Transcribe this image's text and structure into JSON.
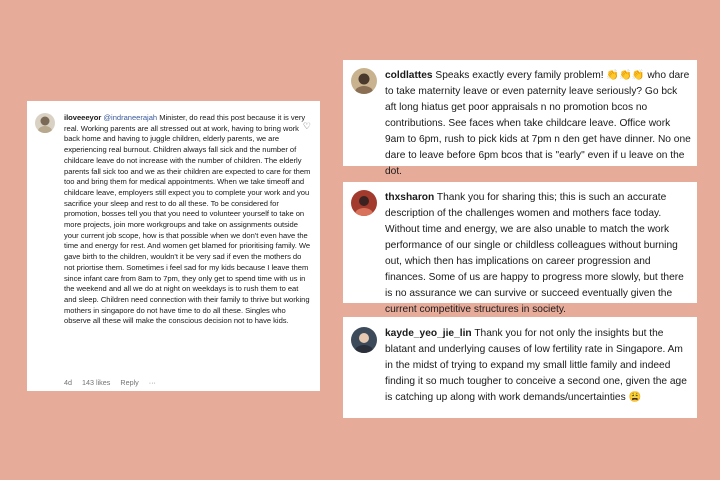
{
  "comments": {
    "left": {
      "username": "iloveeeyor",
      "mention": "@indraneerajah",
      "text": "Minister, do read this post because it is very real. Working parents are all stressed out at work, having to bring work back home and having to juggle children, elderly parents, we are experiencing real burnout. Children always fall sick and the number of childcare leave do not increase with the number of children. The elderly parents fall sick too and we as their children are expected to care for them too and bring them for medical appointments. When we take timeoff and childcare leave, employers still expect you to complete your work and you sacrifice your sleep and rest to do all these. To be considered for promotion, bosses tell you that you need to volunteer yourself to take on more projects, join more workgroups and take on assignments outside your current job scope, how is that possible when we don't even have the time and energy for rest. And women get blamed for prioritising family. We gave birth to the children, wouldn't it be very sad if even the mothers do not priortise them. Sometimes i feel sad for my kids because I leave them since infant care from 8am to 7pm, they only get to spend time with us in the weekend and all we do at night on weekdays is to rush them to eat and sleep. Children need connection with their family to thrive but working mothers in singapore do not have time to do all these. Singles who observe all these will make the conscious decision not to have kids.",
      "age": "4d",
      "likes": "143 likes",
      "reply": "Reply",
      "more": "···",
      "heart_icon": "heart-outline-icon"
    },
    "right": [
      {
        "username": "coldlattes",
        "text_before": "Speaks exactly every family problem!",
        "emoji": "👏👏👏",
        "text_after": "who dare to take maternity leave or even paternity leave seriously? Go bck aft long hiatus get poor appraisals n no promotion bcos no contributions. See faces when take childcare leave. Office work 9am to 6pm, rush to pick kids at 7pm n den get have dinner. No one dare to leave before 6pm bcos that is \"early\" even if u leave on the dot."
      },
      {
        "username": "thxsharon",
        "text": "Thank you for sharing this; this is such an accurate description of the challenges women and mothers face today. Without time and energy, we are also unable to match the work performance of our single or childless colleagues without burning out, which then has implications on career progression and finances. Some of us are happy to progress more slowly, but there is no assurance we can survive or succeed eventually given the current competitive structures in society."
      },
      {
        "username": "kayde_yeo_jie_lin",
        "text": "Thank you for not only the insights but the blatant and underlying causes of low fertility rate in Singapore. Am in the midst of trying to expand my small little family and indeed finding it so much tougher to conceive a second one, given the age is catching up along with work demands/uncertainties",
        "emoji": "😩"
      }
    ]
  },
  "colors": {
    "background": "#e7ab9a",
    "card": "#ffffff",
    "mention": "#3b5a9a",
    "meta": "#737373"
  }
}
